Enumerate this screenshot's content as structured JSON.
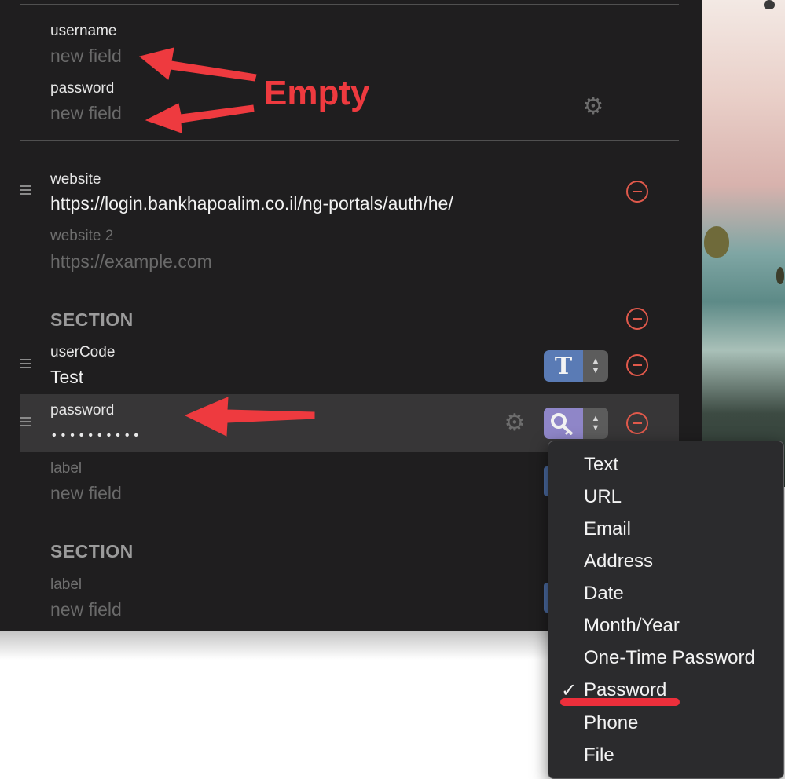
{
  "annotation": {
    "text": "Empty",
    "color": "#ee3a3f"
  },
  "login": {
    "username": {
      "label": "username",
      "placeholder": "new field"
    },
    "password": {
      "label": "password",
      "placeholder": "new field"
    }
  },
  "websites": [
    {
      "label": "website",
      "value": "https://login.bankhapoalim.co.il/ng-portals/auth/he/"
    },
    {
      "label": "website 2",
      "placeholder": "https://example.com"
    }
  ],
  "sections": [
    {
      "title": "SECTION",
      "fields": [
        {
          "label": "userCode",
          "value": "Test",
          "type_icon": "T"
        },
        {
          "label": "password",
          "value": "••••••••••",
          "type_icon": "key-icon"
        },
        {
          "label": "label",
          "placeholder": "new field"
        }
      ]
    },
    {
      "title": "SECTION",
      "fields": [
        {
          "label": "label",
          "placeholder": "new field"
        }
      ]
    }
  ],
  "type_menu": {
    "selected": "Password",
    "items": [
      "Text",
      "URL",
      "Email",
      "Address",
      "Date",
      "Month/Year",
      "One-Time Password",
      "Password",
      "Phone",
      "File"
    ]
  },
  "colors": {
    "panel_bg": "#1f1e1f",
    "remove_red": "#e0594b",
    "text_type_blue": "#5a7bb5",
    "password_type_purple": "#8f86c8"
  }
}
